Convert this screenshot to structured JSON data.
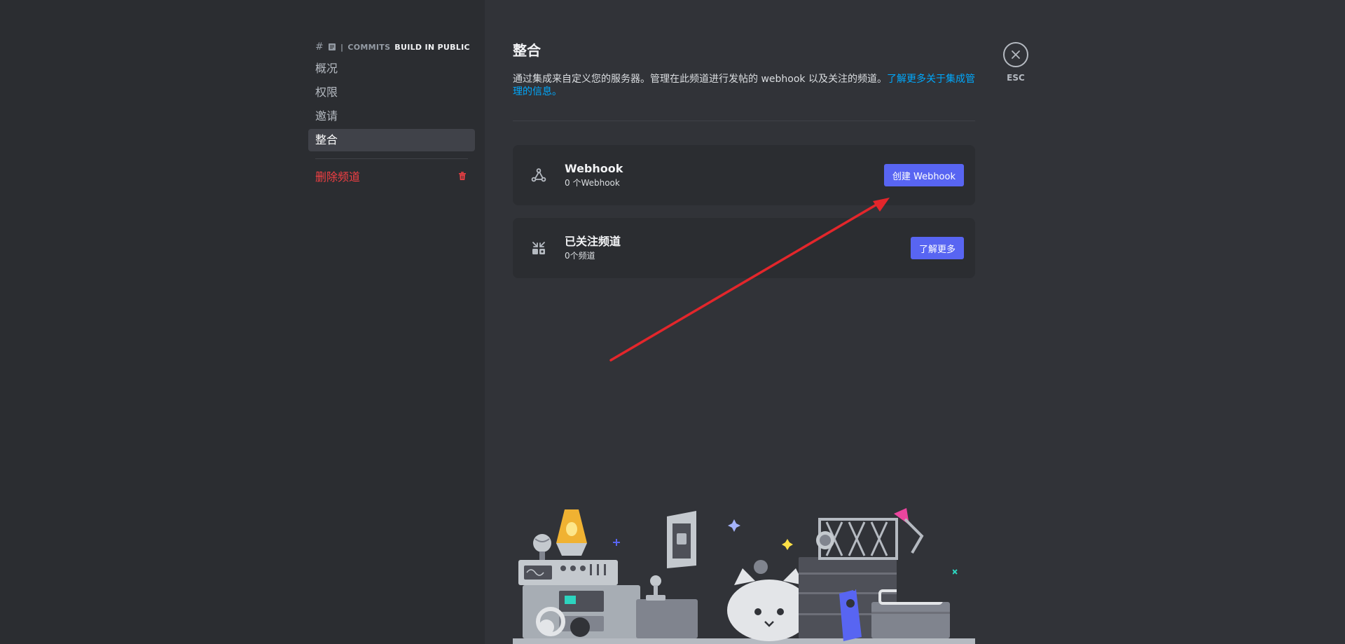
{
  "sidebar": {
    "channel_header": {
      "hash": "#",
      "separator": "|",
      "category": "COMMITS",
      "channel": "BUILD IN PUBLIC"
    },
    "items": [
      {
        "label": "概况"
      },
      {
        "label": "权限"
      },
      {
        "label": "邀请"
      },
      {
        "label": "整合",
        "active": true
      }
    ],
    "delete_label": "删除频道"
  },
  "main": {
    "title": "整合",
    "description": "通过集成来自定义您的服务器。管理在此频道进行发帖的 webhook 以及关注的频道。",
    "description_link": "了解更多关于集成管理的信息。",
    "cards": [
      {
        "title": "Webhook",
        "subtitle": "0 个Webhook",
        "button": "创建 Webhook",
        "icon": "webhook-icon"
      },
      {
        "title": "已关注频道",
        "subtitle": "0个频道",
        "button": "了解更多",
        "icon": "followed-channels-icon"
      }
    ]
  },
  "close": {
    "label": "ESC"
  },
  "colors": {
    "accent": "#5865f2",
    "danger": "#f23f43",
    "link": "#00a8fc",
    "annotation_arrow": "#e3262b"
  }
}
